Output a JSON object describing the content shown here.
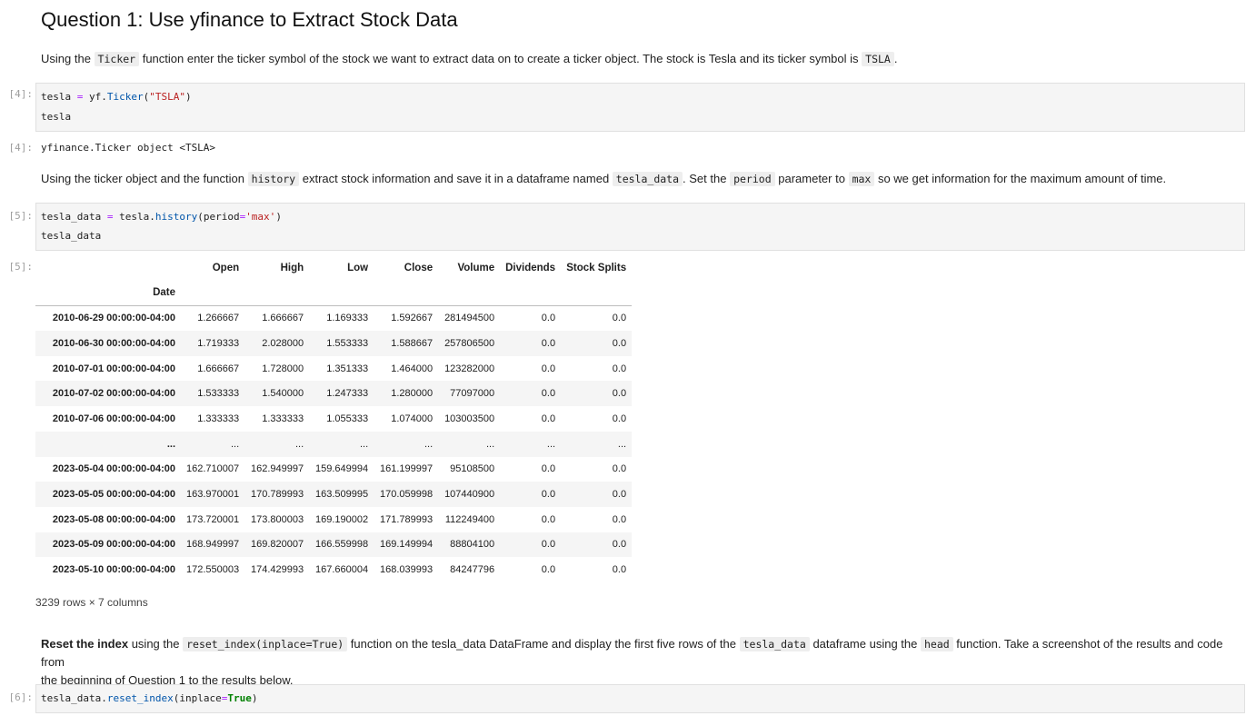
{
  "heading": "Question 1: Use yfinance to Extract Stock Data",
  "md1": {
    "t1": "Using the ",
    "code1": "Ticker",
    "t2": " function enter the ticker symbol of the stock we want to extract data on to create a ticker object. The stock is Tesla and its ticker symbol is ",
    "code2": "TSLA",
    "t3": "."
  },
  "cell4": {
    "prompt": "[4]:",
    "l1_a": "tesla ",
    "l1_eq": "=",
    "l1_b": " yf.",
    "l1_fn": "Ticker",
    "l1_c": "(",
    "l1_str": "\"TSLA\"",
    "l1_d": ")",
    "l2": "tesla"
  },
  "out4": {
    "prompt": "[4]:",
    "text": "yfinance.Ticker object <TSLA>"
  },
  "md2": {
    "t1": "Using the ticker object and the function ",
    "code1": "history",
    "t2": " extract stock information and save it in a dataframe named ",
    "code2": "tesla_data",
    "t3": ". Set the ",
    "code3": "period",
    "t4": " parameter to ",
    "code4": "max",
    "t5": " so we get information for the maximum amount of time."
  },
  "cell5": {
    "prompt": "[5]:",
    "l1_a": "tesla_data ",
    "l1_eq": "=",
    "l1_b": " tesla.",
    "l1_fn": "history",
    "l1_c": "(period",
    "l1_eq2": "=",
    "l1_str": "'max'",
    "l1_d": ")",
    "l2": "tesla_data"
  },
  "out5": {
    "prompt": "[5]:",
    "columns": [
      "Open",
      "High",
      "Low",
      "Close",
      "Volume",
      "Dividends",
      "Stock Splits"
    ],
    "index_name": "Date",
    "rows": [
      {
        "date": "2010-06-29 00:00:00-04:00",
        "vals": [
          "1.266667",
          "1.666667",
          "1.169333",
          "1.592667",
          "281494500",
          "0.0",
          "0.0"
        ]
      },
      {
        "date": "2010-06-30 00:00:00-04:00",
        "vals": [
          "1.719333",
          "2.028000",
          "1.553333",
          "1.588667",
          "257806500",
          "0.0",
          "0.0"
        ]
      },
      {
        "date": "2010-07-01 00:00:00-04:00",
        "vals": [
          "1.666667",
          "1.728000",
          "1.351333",
          "1.464000",
          "123282000",
          "0.0",
          "0.0"
        ]
      },
      {
        "date": "2010-07-02 00:00:00-04:00",
        "vals": [
          "1.533333",
          "1.540000",
          "1.247333",
          "1.280000",
          "77097000",
          "0.0",
          "0.0"
        ]
      },
      {
        "date": "2010-07-06 00:00:00-04:00",
        "vals": [
          "1.333333",
          "1.333333",
          "1.055333",
          "1.074000",
          "103003500",
          "0.0",
          "0.0"
        ]
      },
      {
        "date": "...",
        "vals": [
          "...",
          "...",
          "...",
          "...",
          "...",
          "...",
          "..."
        ]
      },
      {
        "date": "2023-05-04 00:00:00-04:00",
        "vals": [
          "162.710007",
          "162.949997",
          "159.649994",
          "161.199997",
          "95108500",
          "0.0",
          "0.0"
        ]
      },
      {
        "date": "2023-05-05 00:00:00-04:00",
        "vals": [
          "163.970001",
          "170.789993",
          "163.509995",
          "170.059998",
          "107440900",
          "0.0",
          "0.0"
        ]
      },
      {
        "date": "2023-05-08 00:00:00-04:00",
        "vals": [
          "173.720001",
          "173.800003",
          "169.190002",
          "171.789993",
          "112249400",
          "0.0",
          "0.0"
        ]
      },
      {
        "date": "2023-05-09 00:00:00-04:00",
        "vals": [
          "168.949997",
          "169.820007",
          "166.559998",
          "169.149994",
          "88804100",
          "0.0",
          "0.0"
        ]
      },
      {
        "date": "2023-05-10 00:00:00-04:00",
        "vals": [
          "172.550003",
          "174.429993",
          "167.660004",
          "168.039993",
          "84247796",
          "0.0",
          "0.0"
        ]
      }
    ],
    "shape": "3239 rows × 7 columns"
  },
  "md3": {
    "bold": "Reset the index",
    "t1": " using the ",
    "code1": "reset_index(inplace=True)",
    "t2": " function on the tesla_data DataFrame and display the first five rows of the ",
    "code2": "tesla_data",
    "t3": " dataframe using the ",
    "code3": "head",
    "t4": " function. Take a screenshot of the results and code from",
    "t5": "the beginning of Question 1 to the results below."
  },
  "cell6": {
    "prompt": "[6]:",
    "l1_a": "tesla_data.",
    "l1_fn": "reset_index",
    "l1_b": "(inplace",
    "l1_eq": "=",
    "l1_kw": "True",
    "l1_c": ")"
  }
}
